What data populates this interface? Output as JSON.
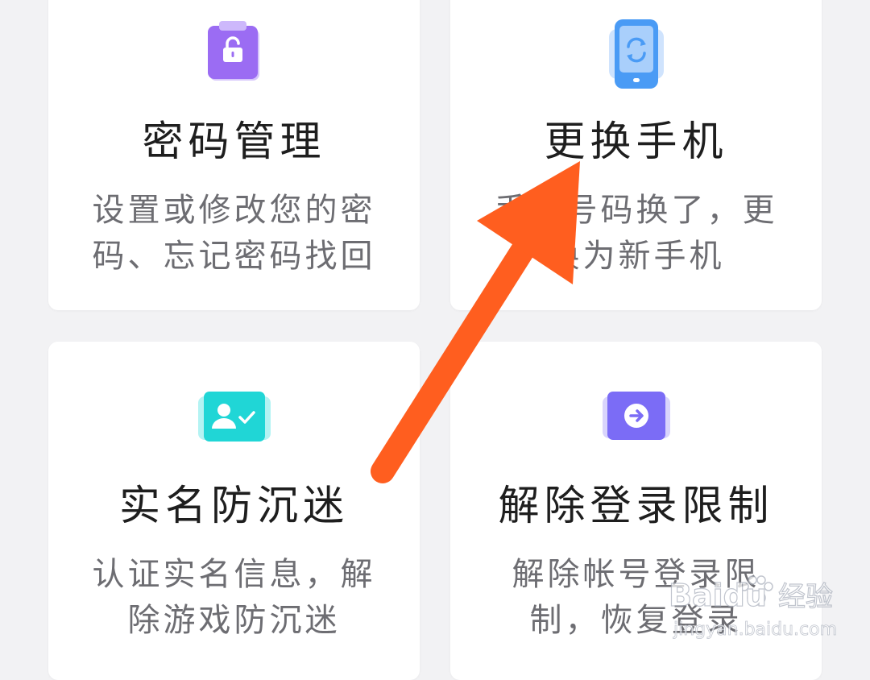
{
  "cards": [
    {
      "title": "密码管理",
      "desc_lines": [
        "设置或修改您的密",
        "码、忘记密码找回"
      ],
      "icon": "lock-clipboard-icon",
      "color": "#9b6cf3"
    },
    {
      "title": "更换手机",
      "desc_lines": [
        "手机号码换了，更",
        "换为新手机"
      ],
      "icon": "phone-switch-icon",
      "color": "#4a9bf5"
    },
    {
      "title": "实名防沉迷",
      "desc_lines": [
        "认证实名信息，解",
        "除游戏防沉迷"
      ],
      "icon": "id-verify-icon",
      "color": "#20d6d6"
    },
    {
      "title": "解除登录限制",
      "desc_lines": [
        "解除帐号登录限",
        "制，恢复登录"
      ],
      "icon": "login-arrow-icon",
      "color": "#7b6cf6"
    }
  ],
  "annotation": {
    "arrow_color": "#ff5e1f",
    "arrow_icon": "annotation-arrow-icon"
  },
  "watermark": {
    "brand": "Baidu",
    "label": "经验",
    "url": "jingyan.baidu.com"
  },
  "colors": {
    "background": "#f2f2f4",
    "card": "#ffffff",
    "title": "#1e1e1e",
    "desc": "#6d6d72"
  }
}
